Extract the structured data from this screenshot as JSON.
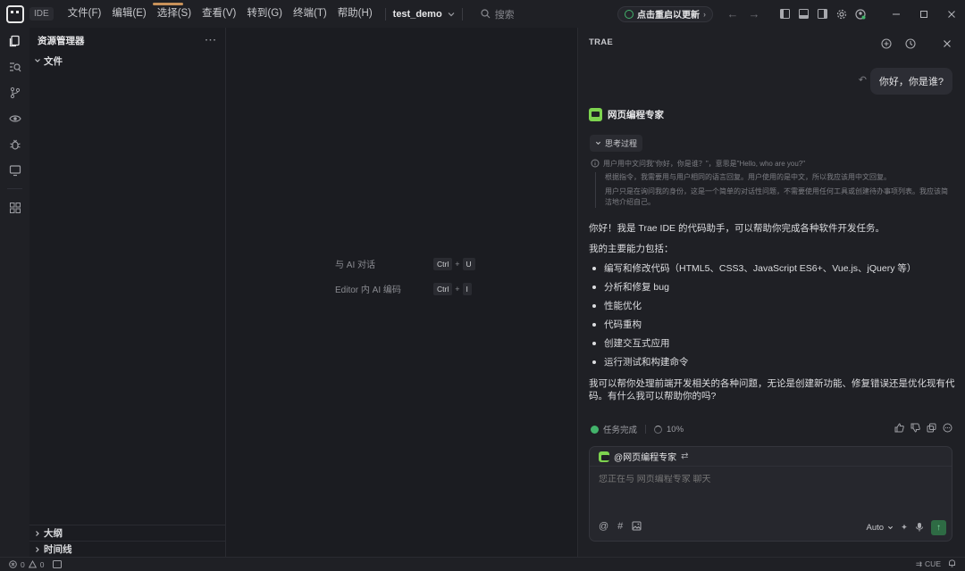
{
  "titlebar": {
    "ide_badge": "IDE",
    "menu": [
      "文件(F)",
      "编辑(E)",
      "选择(S)",
      "查看(V)",
      "转到(G)",
      "终端(T)",
      "帮助(H)"
    ],
    "project": "test_demo",
    "search_placeholder": "搜索",
    "update_label": "点击重启以更新"
  },
  "explorer": {
    "title": "资源管理器",
    "files_section": "文件",
    "outline_section": "大纲",
    "timeline_section": "时间线"
  },
  "editor": {
    "hints": [
      {
        "label": "与 AI 对话",
        "keys": [
          "Ctrl",
          "U"
        ]
      },
      {
        "label": "Editor 内 AI 编码",
        "keys": [
          "Ctrl",
          "I"
        ]
      }
    ]
  },
  "chat": {
    "header": "TRAE",
    "user_message": "你好，你是谁?",
    "agent_name": "网页编程专家",
    "think_label": "思考过程",
    "think_lines": [
      "用户用中文问我\"你好，你是谁？\"，意思是\"Hello, who are you?\"",
      "根据指令，我需要用与用户相同的语言回复。用户使用的是中文，所以我应该用中文回复。",
      "用户只是在询问我的身份，这是一个简单的对话性问题，不需要使用任何工具或创建待办事项列表。我应该简洁地介绍自己。"
    ],
    "answer_intro": "你好！我是 Trae IDE 的代码助手，可以帮助你完成各种软件开发任务。",
    "capabilities_heading": "我的主要能力包括：",
    "capabilities": [
      "编写和修改代码（HTML5、CSS3、JavaScript ES6+、Vue.js、jQuery 等）",
      "分析和修复 bug",
      "性能优化",
      "代码重构",
      "创建交互式应用",
      "运行测试和构建命令"
    ],
    "answer_outro": "我可以帮你处理前端开发相关的各种问题，无论是创建新功能、修复错误还是优化现有代码。有什么我可以帮助你的吗?",
    "task_status": "任务完成",
    "progress": "10%",
    "input_mention": "@网页编程专家",
    "input_placeholder": "您正在与 网页编程专家 聊天",
    "model": "Auto"
  },
  "statusbar": {
    "errors": "0",
    "warnings": "0",
    "right_label": "CUE"
  },
  "colors": {
    "accent_green": "#43b36b",
    "agent_logo": "#7dd34f",
    "background": "#1b1c21"
  }
}
